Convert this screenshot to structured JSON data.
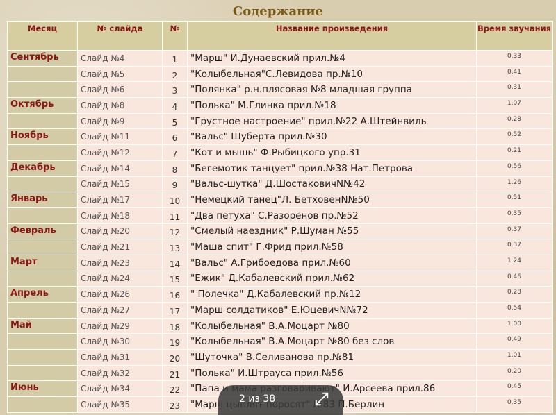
{
  "title": "Содержание",
  "columns": [
    "Месяц",
    "№ слайда",
    "№",
    "Название произведения",
    "Время звучания"
  ],
  "rows": [
    {
      "month": "Сентябрь",
      "slide": "Слайд №4",
      "num": "1",
      "work": "\"Марш\" И.Дунаевский прил.№4",
      "time": "0.33"
    },
    {
      "month": "",
      "slide": "Слайд №5",
      "num": "2",
      "work": "\"Колыбельная\"С.Левидова пр.№10",
      "time": "0.41"
    },
    {
      "month": "",
      "slide": "Слайд №6",
      "num": "3",
      "work": "\"Полянка\" р.н.плясовая №8 младшая группа",
      "time": "0.31"
    },
    {
      "month": "Октябрь",
      "slide": "Слайд №8",
      "num": "4",
      "work": "\"Полька\" М.Глинка прил.№18",
      "time": "1.07"
    },
    {
      "month": "",
      "slide": "Слайд №9",
      "num": "5",
      "work": "\"Грустное настроение\" прил.№22 А.Штейнвиль",
      "time": "0.28"
    },
    {
      "month": "Ноябрь",
      "slide": "Слайд №11",
      "num": "6",
      "work": "\"Вальс\" Шуберта прил.№30",
      "time": "0.52"
    },
    {
      "month": "",
      "slide": "Слайд №12",
      "num": "7",
      "work": "\"Кот и мышь\" Ф.Рыбицкого упр.31",
      "time": "0.21"
    },
    {
      "month": "Декабрь",
      "slide": "Слайд №14",
      "num": "8",
      "work": "\"Бегемотик танцует\" прил.№38  Нат.Петрова",
      "time": "0.56"
    },
    {
      "month": "",
      "slide": "Слайд №15",
      "num": "9",
      "work": "\"Вальс-шутка\" Д.ШостаковичN№42",
      "time": "1.26"
    },
    {
      "month": "Январь",
      "slide": "Слайд №17",
      "num": "10",
      "work": "\"Немецкий танец\"Л. БетховенN№50",
      "time": "0.51"
    },
    {
      "month": "",
      "slide": "Слайд №18",
      "num": "11",
      "work": "\"Два петуха\" С.Разоренов пр.№52",
      "time": "0.35"
    },
    {
      "month": "Февраль",
      "slide": "Слайд №20",
      "num": "12",
      "work": "\"Смелый наездник\" Р.Шуман №55",
      "time": "0.37"
    },
    {
      "month": "",
      "slide": "Слайд №21",
      "num": "13",
      "work": "\"Маша спит\" Г.Фрид прил.№58",
      "time": "0.37"
    },
    {
      "month": "Март",
      "slide": "Слайд №23",
      "num": "14",
      "work": "\"Вальс\" А.Грибоедова прил.№60",
      "time": "1.24"
    },
    {
      "month": "",
      "slide": "Слайд №24",
      "num": "15",
      "work": "\"Ежик\" Д.Кабалевский прил.№62",
      "time": "0.46"
    },
    {
      "month": "Апрель",
      "slide": "Слайд №26",
      "num": "16",
      "work": "\" Полечка\" Д.Кабалевский пр.№12",
      "time": "0.28"
    },
    {
      "month": "",
      "slide": "Слайд №27",
      "num": "17",
      "work": "\"Марш солдатиков\" Е.ЮцевичN№72",
      "time": "0.54"
    },
    {
      "month": "Май",
      "slide": "Слайд №29",
      "num": "18",
      "work": "\"Колыбельная\" В.А.Моцарт №80",
      "time": "1.00"
    },
    {
      "month": "",
      "slide": "Слайд №30",
      "num": "19",
      "work": "\"Колыбельная\" В.А.Моцарт №80 без слов",
      "time": "0.49"
    },
    {
      "month": "",
      "slide": "Слайд №31",
      "num": "20",
      "work": "\"Шуточка\" В.Селиванова пр.№81",
      "time": "1.01"
    },
    {
      "month": "",
      "slide": "Слайд №32",
      "num": "21",
      "work": "\"Полька\" И.Штрауса прил.№56",
      "time": "0.20"
    },
    {
      "month": "Июнь",
      "slide": "Слайд №34",
      "num": "22",
      "work": "\"Папа и мама разговаривают\" И.Арсеева прил.86",
      "time": "0.45"
    },
    {
      "month": "",
      "slide": "Слайд №35",
      "num": "23",
      "work": "\"Марш цыплят поросят\" №83 П.Берлин",
      "time": "0.35"
    }
  ],
  "pager": {
    "text": "2 из 38",
    "expand_icon": "expand-icon"
  },
  "colors": {
    "header_bg": "#d6cea0",
    "header_text": "#8a1818",
    "cell_bg": "#f9e6dc",
    "title": "#7a5a14",
    "pager_bg": "#373737"
  }
}
